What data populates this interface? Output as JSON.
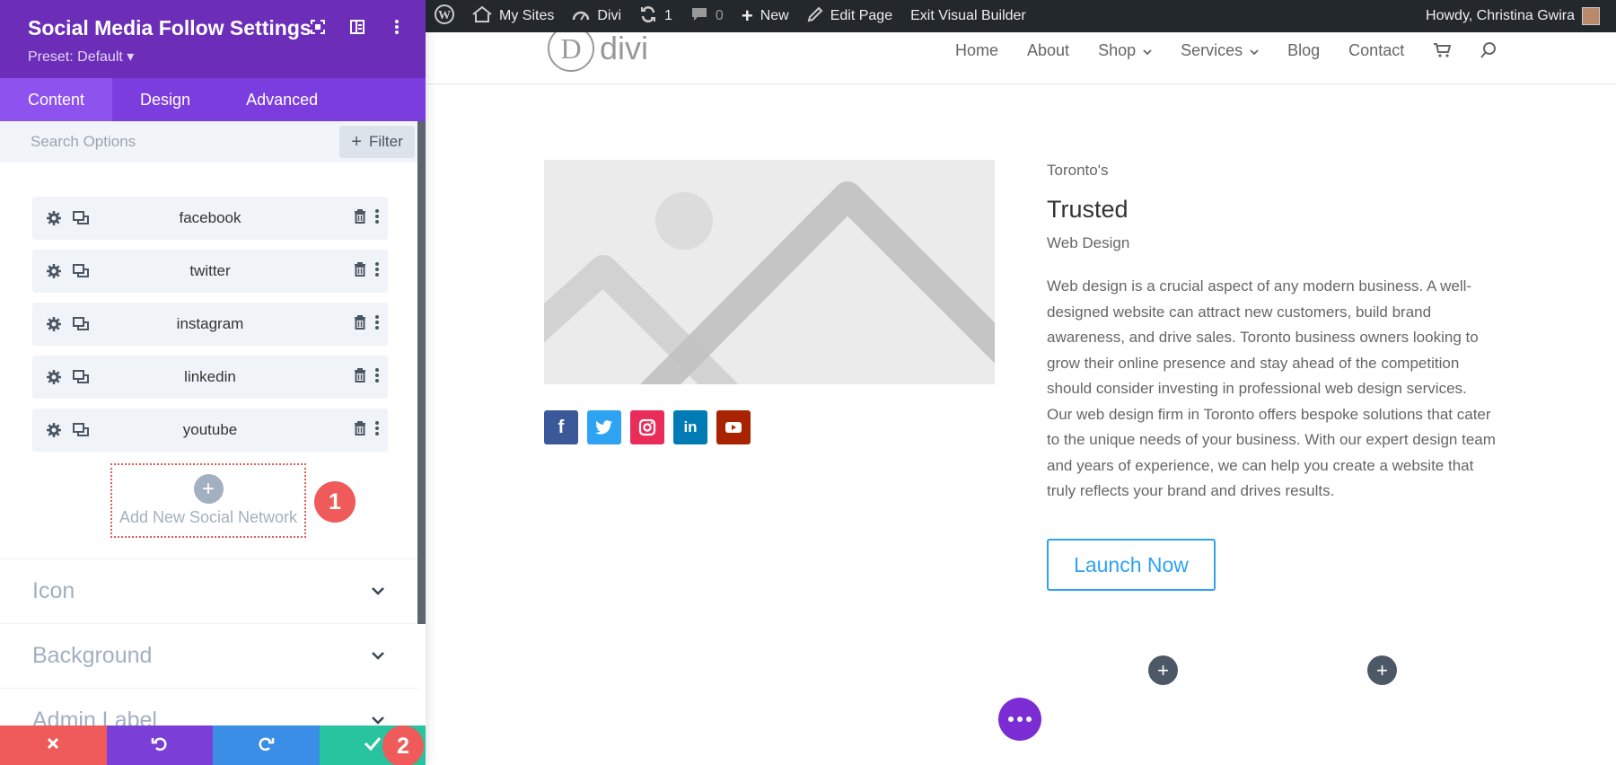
{
  "panel": {
    "title": "Social Media Follow Settings",
    "preset": "Preset: Default ▾",
    "tabs": [
      {
        "label": "Content",
        "active": true
      },
      {
        "label": "Design",
        "active": false
      },
      {
        "label": "Advanced",
        "active": false
      }
    ],
    "search_placeholder": "Search Options",
    "filter_label": "Filter",
    "networks": [
      {
        "label": "facebook"
      },
      {
        "label": "twitter"
      },
      {
        "label": "instagram"
      },
      {
        "label": "linkedin"
      },
      {
        "label": "youtube"
      }
    ],
    "add_new_label": "Add New Social Network",
    "toggles": [
      {
        "label": "Icon"
      },
      {
        "label": "Background"
      },
      {
        "label": "Admin Label"
      }
    ],
    "badges": [
      "1",
      "2"
    ],
    "colors": {
      "header": "#6c2eb9",
      "tabs": "#7c3ddf",
      "cancel": "#ef5a5a",
      "undo": "#7b3fd8",
      "redo": "#3a8ee6",
      "save": "#28c4a0"
    }
  },
  "adminbar": {
    "items": [
      {
        "label": "",
        "icon": "wordpress-icon"
      },
      {
        "label": "My Sites",
        "icon": "my-sites-icon"
      },
      {
        "label": "Divi",
        "icon": "dashboard-icon"
      },
      {
        "label": "1",
        "icon": "updates-icon"
      },
      {
        "label": "0",
        "icon": "comments-icon"
      },
      {
        "label": "New",
        "icon": "plus-icon"
      },
      {
        "label": "Edit Page",
        "icon": "pencil-icon"
      },
      {
        "label": "Exit Visual Builder",
        "icon": ""
      }
    ],
    "greeting": "Howdy, Christina Gwira"
  },
  "site": {
    "logo_letter": "D",
    "logo_text": "divi",
    "nav": [
      {
        "label": "Home"
      },
      {
        "label": "About"
      },
      {
        "label": "Shop",
        "dropdown": true
      },
      {
        "label": "Services",
        "dropdown": true
      },
      {
        "label": "Blog"
      },
      {
        "label": "Contact"
      }
    ]
  },
  "content": {
    "kicker": "Toronto's",
    "headline": "Trusted",
    "subhead": "Web Design",
    "body": "Web design is a crucial aspect of any modern business. A well-designed website can attract new customers, build brand awareness, and drive sales. Toronto business owners looking to grow their online presence and stay ahead of the competition should consider investing in professional web design services. Our web design firm in Toronto offers bespoke solutions that cater to the unique needs of your business. With our expert design team and years of experience, we can help you create a website that truly reflects your brand and drives results.",
    "button_label": "Launch Now",
    "social_icons": [
      {
        "name": "facebook",
        "glyph": "f",
        "color": "#3b5998"
      },
      {
        "name": "twitter",
        "glyph": "t",
        "color": "#2ea3f2"
      },
      {
        "name": "instagram",
        "glyph": "◎",
        "color": "#ea2c59"
      },
      {
        "name": "linkedin",
        "glyph": "in",
        "color": "#007bb6"
      },
      {
        "name": "youtube",
        "glyph": "▶",
        "color": "#a82400"
      }
    ]
  }
}
